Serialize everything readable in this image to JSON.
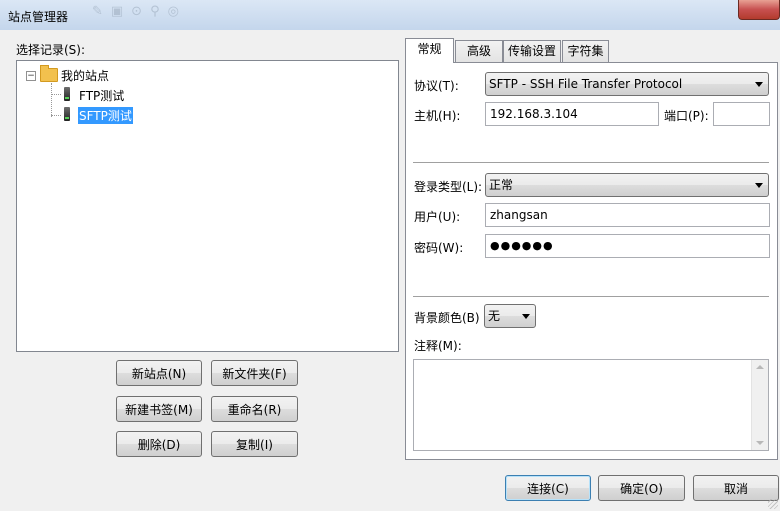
{
  "window": {
    "title": "站点管理器"
  },
  "left": {
    "select_label": "选择记录(S):",
    "tree": {
      "root": "我的站点",
      "children": [
        {
          "label": "FTP测试",
          "selected": false
        },
        {
          "label": "SFTP测试",
          "selected": true
        }
      ]
    },
    "buttons": {
      "new_site": "新站点(N)",
      "new_folder": "新文件夹(F)",
      "new_bookmark": "新建书签(M)",
      "rename": "重命名(R)",
      "delete": "删除(D)",
      "copy": "复制(I)"
    }
  },
  "tabs": [
    {
      "label": "常规",
      "active": true
    },
    {
      "label": "高级",
      "active": false
    },
    {
      "label": "传输设置",
      "active": false
    },
    {
      "label": "字符集",
      "active": false
    }
  ],
  "general": {
    "protocol_label": "协议(T):",
    "protocol_value": "SFTP - SSH File Transfer Protocol",
    "host_label": "主机(H):",
    "host_value": "192.168.3.104",
    "port_label": "端口(P):",
    "port_value": "",
    "logon_type_label": "登录类型(L):",
    "logon_type_value": "正常",
    "user_label": "用户(U):",
    "user_value": "zhangsan",
    "password_label": "密码(W):",
    "password_value": "●●●●●●",
    "bg_color_label": "背景颜色(B)",
    "bg_color_value": "无",
    "comments_label": "注释(M):",
    "comments_value": ""
  },
  "footer": {
    "connect": "连接(C)",
    "ok": "确定(O)",
    "cancel": "取消"
  },
  "colors": {
    "selection": "#3399ff",
    "close_button": "#c75050"
  },
  "icons": [
    "folder-icon",
    "server-icon",
    "close-icon",
    "combo-arrow-icon"
  ]
}
